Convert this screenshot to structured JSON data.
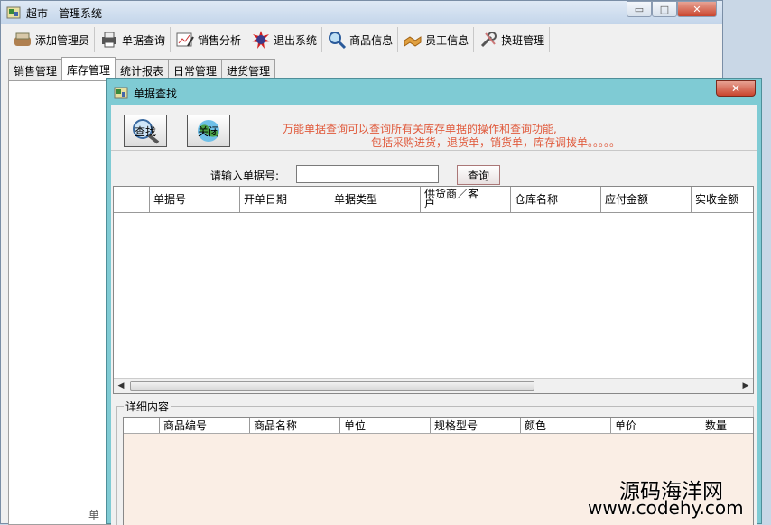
{
  "main_window": {
    "title": "超市 - 管理系统",
    "min_label": "▭",
    "max_label": "□",
    "close_label": "✕"
  },
  "toolbar": {
    "items": [
      {
        "label": "添加管理员",
        "icon": "admin-icon"
      },
      {
        "label": "单据查询",
        "icon": "printer-icon"
      },
      {
        "label": "销售分析",
        "icon": "chart-pen-icon"
      },
      {
        "label": "退出系统",
        "icon": "new-badge-icon"
      },
      {
        "label": "商品信息",
        "icon": "magnifier-icon"
      },
      {
        "label": "员工信息",
        "icon": "handshake-icon"
      },
      {
        "label": "换班管理",
        "icon": "tools-icon"
      }
    ]
  },
  "tabs": [
    {
      "label": "销售管理"
    },
    {
      "label": "库存管理"
    },
    {
      "label": "统计报表"
    },
    {
      "label": "日常管理"
    },
    {
      "label": "进货管理"
    }
  ],
  "active_tab": 1,
  "behind_text": "单",
  "dialog": {
    "title": "单据查找",
    "close_label": "✕",
    "find_button": "查找",
    "close_button": "关闭",
    "info_line1": "万能单据查询可以查询所有关库存单据的操作和查询功能,",
    "info_line2": "包括采购进货，退货单，销货单，库存调拨单。。。。。",
    "search_label": "请输入单据号:",
    "search_value": "",
    "search_button": "查询",
    "grid_columns": [
      "",
      "单据号",
      "开单日期",
      "单据类型",
      "供货商／客户",
      "仓库名称",
      "应付金额",
      "实收金额"
    ],
    "detail_legend": "详细内容",
    "detail_columns": [
      "",
      "商品编号",
      "商品名称",
      "单位",
      "规格型号",
      "颜色",
      "单价",
      "数量"
    ]
  },
  "watermark": {
    "line1": "源码海洋网",
    "line2": "www.codehy.com"
  },
  "colors": {
    "dialog_frame": "#7fcbd4",
    "info_text": "#e05a3c",
    "detail_bg": "#faeee5"
  }
}
